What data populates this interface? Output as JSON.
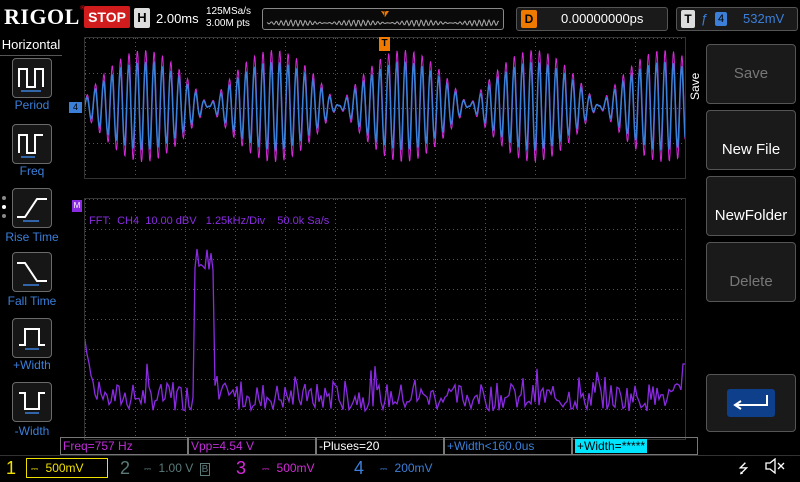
{
  "brand": {
    "name": "RIGOL"
  },
  "status": {
    "run_state": "STOP"
  },
  "timebase": {
    "key": "H",
    "value": "2.00ms",
    "sample_rate": "125MSa/s",
    "memory_depth": "3.00M pts"
  },
  "delay": {
    "key": "D",
    "value": "0.00000000ps"
  },
  "trigger": {
    "key": "T",
    "channel": "4",
    "level": "532mV"
  },
  "left_menu": {
    "title": "Horizontal",
    "items": [
      {
        "label": "Period"
      },
      {
        "label": "Freq"
      },
      {
        "label": "Rise Time"
      },
      {
        "label": "Fall Time"
      },
      {
        "label": "+Width"
      },
      {
        "label": "-Width"
      }
    ]
  },
  "fft": {
    "info": "FFT:  CH4  10.00 dBV   1.25kHz/Div    50.0k Sa/s"
  },
  "right_menu": {
    "title": "Save",
    "items": [
      {
        "label": "Save",
        "enabled": false
      },
      {
        "label": "New File",
        "enabled": true
      },
      {
        "label": "NewFolder",
        "enabled": true
      },
      {
        "label": "Delete",
        "enabled": false
      }
    ]
  },
  "measurements": [
    {
      "text": "Freq=757 Hz",
      "color": "#c02ed8"
    },
    {
      "text": "Vpp=4.54 V",
      "color": "#c02ed8"
    },
    {
      "text": "-Pluses=20",
      "color": "#ffffff"
    },
    {
      "text": "+Width<160.0us",
      "color": "#3b7fd9"
    },
    {
      "text": "+Width=*****",
      "color": "#00e5ff"
    }
  ],
  "channels": [
    {
      "num": "1",
      "scale": "500mV",
      "color": "#f0e000"
    },
    {
      "num": "2",
      "scale": "1.00 V",
      "color": "#5a7a7a"
    },
    {
      "num": "3",
      "scale": "500mV",
      "color": "#d42ad8"
    },
    {
      "num": "4",
      "scale": "200mV",
      "color": "#3b7fd9"
    }
  ],
  "markers": {
    "ch4": "4",
    "fft": "M"
  },
  "colors": {
    "ch3": "#d42ad8",
    "ch4": "#3b7fd9",
    "fft": "#8a2be2",
    "accent": "#e0101a"
  }
}
